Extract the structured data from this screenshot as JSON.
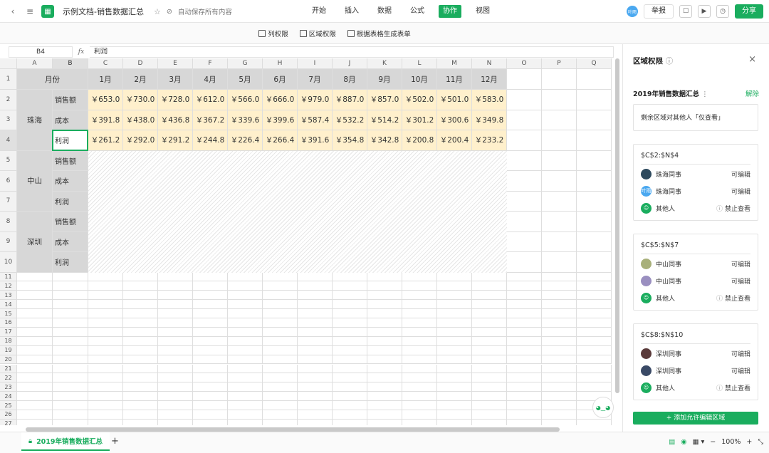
{
  "topbar": {
    "doc_title": "示例文档-销售数据汇总",
    "saved_text": "自动保存所有内容",
    "tabs": [
      "开始",
      "插入",
      "数据",
      "公式",
      "协作",
      "视图"
    ],
    "active_tab": "协作",
    "report_label": "举报",
    "share_label": "分享",
    "user_initials": "叶雨"
  },
  "toolbar": {
    "items": [
      "列权限",
      "区域权限",
      "根据表格生成表单"
    ]
  },
  "formula_bar": {
    "cell_ref": "B4",
    "fx_label": "fx",
    "value": "利润"
  },
  "grid": {
    "columns": [
      "A",
      "B",
      "C",
      "D",
      "E",
      "F",
      "G",
      "H",
      "I",
      "J",
      "K",
      "L",
      "M",
      "N",
      "O",
      "P",
      "Q"
    ],
    "rows": [
      "1",
      "2",
      "3",
      "4",
      "5",
      "6",
      "7",
      "8",
      "9",
      "10",
      "11",
      "12",
      "13",
      "14",
      "15",
      "16",
      "17",
      "18",
      "19",
      "20",
      "21",
      "22",
      "23",
      "24",
      "25",
      "26",
      "27"
    ],
    "header_month_label": "月份",
    "months": [
      "1月",
      "2月",
      "3月",
      "4月",
      "5月",
      "6月",
      "7月",
      "8月",
      "9月",
      "10月",
      "11月",
      "12月"
    ],
    "regions": [
      "珠海",
      "中山",
      "深圳"
    ],
    "metrics": [
      "销售额",
      "成本",
      "利润"
    ],
    "zhuhai_values": [
      [
        "￥653.0",
        "￥730.0",
        "￥728.0",
        "￥612.0",
        "￥566.0",
        "￥666.0",
        "￥979.0",
        "￥887.0",
        "￥857.0",
        "￥502.0",
        "￥501.0",
        "￥583.0"
      ],
      [
        "￥391.8",
        "￥438.0",
        "￥436.8",
        "￥367.2",
        "￥339.6",
        "￥399.6",
        "￥587.4",
        "￥532.2",
        "￥514.2",
        "￥301.2",
        "￥300.6",
        "￥349.8"
      ],
      [
        "￥261.2",
        "￥292.0",
        "￥291.2",
        "￥244.8",
        "￥226.4",
        "￥266.4",
        "￥391.6",
        "￥354.8",
        "￥342.8",
        "￥200.8",
        "￥200.4",
        "￥233.2"
      ]
    ]
  },
  "panel": {
    "title": "区域权限",
    "sheet_name": "2019年销售数据汇总",
    "remove_label": "解除",
    "note": "剩余区域对其他人「仅查看」",
    "cards": [
      {
        "range": "$C$2:$N$4",
        "members": [
          {
            "name": "珠海同事",
            "perm": "可编辑",
            "avatar": "photo",
            "color": "#2e4a5e"
          },
          {
            "name": "珠海同事",
            "perm": "可编辑",
            "avatar": "initials",
            "color": "#4aa8f0"
          },
          {
            "name": "其他人",
            "perm": "禁止查看",
            "avatar": "group",
            "color": "#1aad5e"
          }
        ]
      },
      {
        "range": "$C$5:$N$7",
        "members": [
          {
            "name": "中山同事",
            "perm": "可编辑",
            "avatar": "photo",
            "color": "#a8b07a"
          },
          {
            "name": "中山同事",
            "perm": "可编辑",
            "avatar": "photo",
            "color": "#9a8fc0"
          },
          {
            "name": "其他人",
            "perm": "禁止查看",
            "avatar": "group",
            "color": "#1aad5e"
          }
        ]
      },
      {
        "range": "$C$8:$N$10",
        "members": [
          {
            "name": "深圳同事",
            "perm": "可编辑",
            "avatar": "photo",
            "color": "#5a3a3a"
          },
          {
            "name": "深圳同事",
            "perm": "可编辑",
            "avatar": "photo",
            "color": "#3a4a66"
          },
          {
            "name": "其他人",
            "perm": "禁止查看",
            "avatar": "group",
            "color": "#1aad5e"
          }
        ]
      }
    ],
    "add_button": "+ 添加允许编辑区域"
  },
  "bottom": {
    "sheet_tab": "2019年销售数据汇总",
    "zoom": "100%"
  },
  "colors": {
    "accent": "#1aad5e",
    "highlight": "#fff0cc",
    "header_gray": "#d7d7d7"
  }
}
